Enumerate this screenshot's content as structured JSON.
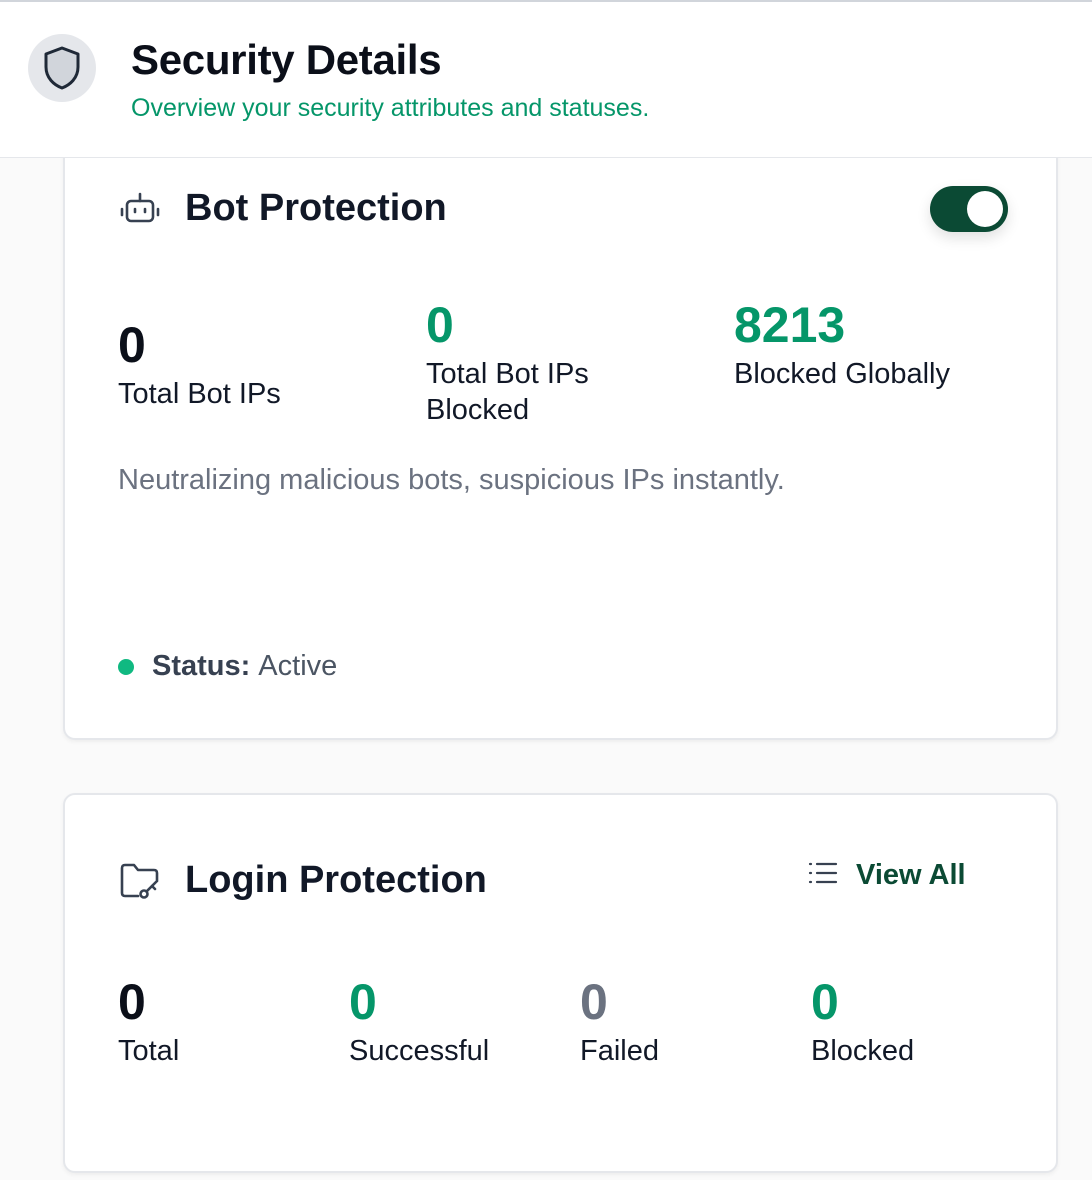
{
  "header": {
    "title": "Security Details",
    "subtitle": "Overview your security attributes and statuses.",
    "icon": "shield-icon"
  },
  "bot_protection": {
    "title": "Bot Protection",
    "icon": "robot-icon",
    "toggle_on": true,
    "stats": [
      {
        "value": "0",
        "label": "Total Bot IPs",
        "color": "#0b0f19"
      },
      {
        "value": "0",
        "label": "Total Bot IPs Blocked",
        "color": "#059669"
      },
      {
        "value": "8213",
        "label": "Blocked Globally",
        "color": "#059669"
      }
    ],
    "description": "Neutralizing malicious bots, suspicious IPs instantly.",
    "status_label": "Status:",
    "status_value": "Active"
  },
  "login_protection": {
    "title": "Login Protection",
    "icon": "folder-key-icon",
    "view_all_label": "View All",
    "stats": [
      {
        "value": "0",
        "label": "Total",
        "color": "#0b0f19"
      },
      {
        "value": "0",
        "label": "Successful",
        "color": "#059669"
      },
      {
        "value": "0",
        "label": "Failed",
        "color": "#6b7280"
      },
      {
        "value": "0",
        "label": "Blocked",
        "color": "#059669"
      }
    ]
  },
  "colors": {
    "accent_green": "#059669",
    "toggle_dark_green": "#0b4a34",
    "status_dot": "#10b981"
  }
}
